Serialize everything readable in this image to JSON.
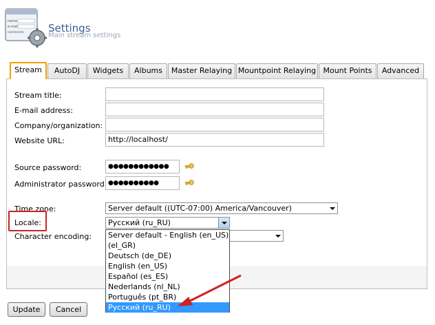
{
  "header": {
    "title": "Settings",
    "subtitle": "Main stream settings",
    "logo_lines": [
      "name",
      "e-mail",
      "comments"
    ]
  },
  "tabs": [
    {
      "label": "Stream",
      "active": true
    },
    {
      "label": "AutoDJ"
    },
    {
      "label": "Widgets"
    },
    {
      "label": "Albums"
    },
    {
      "label": "Master Relaying"
    },
    {
      "label": "Mountpoint Relaying"
    },
    {
      "label": "Mount Points"
    },
    {
      "label": "Advanced"
    }
  ],
  "fields": {
    "stream_title": {
      "label": "Stream title:",
      "value": ""
    },
    "email": {
      "label": "E-mail address:",
      "value": ""
    },
    "company": {
      "label": "Company/organization:",
      "value": ""
    },
    "website": {
      "label": "Website URL:",
      "value": "http://localhost/"
    },
    "source_password": {
      "label": "Source password:",
      "value": "●●●●●●●●●●●●"
    },
    "admin_password": {
      "label": "Administrator password:",
      "value": "●●●●●●●●●●"
    },
    "time_zone": {
      "label": "Time zone:",
      "value": "Server default ((UTC-07:00) America/Vancouver)"
    },
    "locale": {
      "label": "Locale:",
      "value": "Русский (ru_RU)"
    },
    "encoding": {
      "label": "Character encoding:",
      "value": ""
    }
  },
  "locale_options": [
    "Server default - English (en_US)",
    "(el_GR)",
    "Deutsch (de_DE)",
    "English (en_US)",
    "Español (es_ES)",
    "Nederlands (nl_NL)",
    "Português (pt_BR)",
    "Русский (ru_RU)"
  ],
  "locale_selected_index": 7,
  "buttons": {
    "update": "Update",
    "cancel": "Cancel"
  },
  "colors": {
    "active_tab_border": "#f0a000",
    "highlight_box": "#cc2222",
    "arrow": "#cc2222",
    "selected_option": "#3399ff",
    "title": "#3a5f96"
  },
  "icons": {
    "password": "key-icon",
    "logo": "settings-form-gear-icon"
  }
}
